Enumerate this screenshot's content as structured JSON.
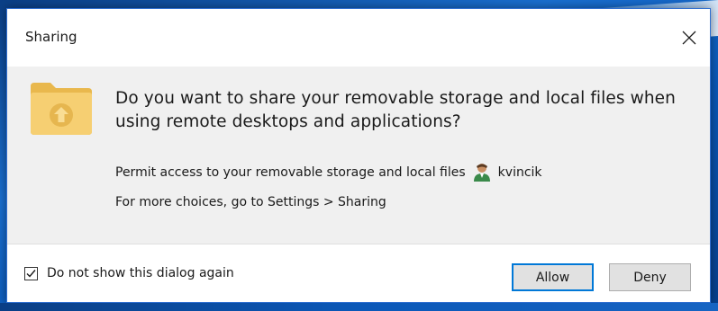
{
  "window": {
    "title": "Sharing"
  },
  "icons": {
    "folder": "folder-upload-icon",
    "user": "user-icon",
    "close": "close-icon",
    "check": "checkmark-icon"
  },
  "content": {
    "heading": "Do you want to share your removable storage and local files when using remote desktops and applications?",
    "permit_text": "Permit access to your removable storage and local files",
    "username": "kvincik",
    "more_choices": "For more choices, go to Settings > Sharing"
  },
  "footer": {
    "checkbox_label": "Do not show this dialog again",
    "checkbox_checked": true,
    "allow_label": "Allow",
    "deny_label": "Deny"
  },
  "colors": {
    "accent": "#0078d7",
    "folder": "#f3c969",
    "content_bg": "#f0f0f0"
  }
}
